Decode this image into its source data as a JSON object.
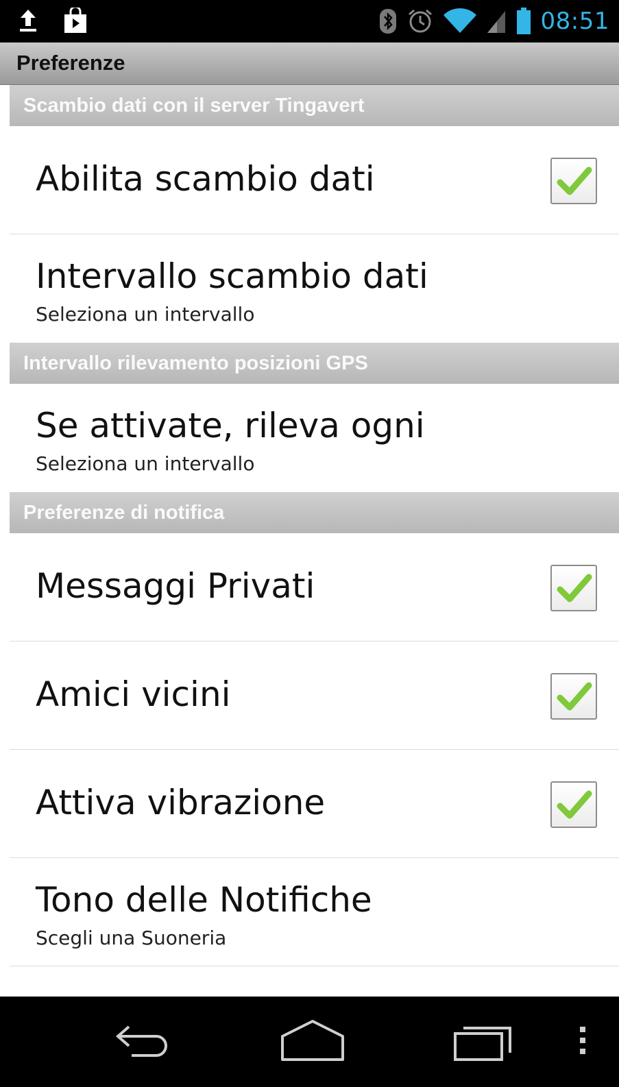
{
  "status_bar": {
    "time": "08:51",
    "left_icons": [
      "upload-icon",
      "shopping-bag-icon"
    ],
    "right_icons": [
      "bluetooth-icon",
      "alarm-icon",
      "wifi-icon",
      "signal-icon",
      "battery-icon"
    ],
    "accent_color": "#33b5e5"
  },
  "title_bar": {
    "title": "Preferenze"
  },
  "sections": [
    {
      "header": "Scambio dati con il server Tingavert",
      "items": [
        {
          "title": "Abilita scambio dati",
          "checked": true
        },
        {
          "title": "Intervallo scambio dati",
          "summary": "Seleziona un intervallo"
        }
      ]
    },
    {
      "header": "Intervallo rilevamento posizioni GPS",
      "items": [
        {
          "title": "Se attivate, rileva ogni",
          "summary": "Seleziona un intervallo"
        }
      ]
    },
    {
      "header": "Preferenze di notifica",
      "items": [
        {
          "title": "Messaggi Privati",
          "checked": true
        },
        {
          "title": "Amici vicini",
          "checked": true
        },
        {
          "title": "Attiva vibrazione",
          "checked": true
        },
        {
          "title": "Tono delle Notifiche",
          "summary": "Scegli una Suoneria"
        }
      ]
    }
  ],
  "nav_bar": {
    "buttons": [
      "back-icon",
      "home-icon",
      "recent-apps-icon",
      "overflow-menu-icon"
    ]
  },
  "colors": {
    "check_green": "#7fc93a",
    "category_bg": "#c3c3c3"
  }
}
